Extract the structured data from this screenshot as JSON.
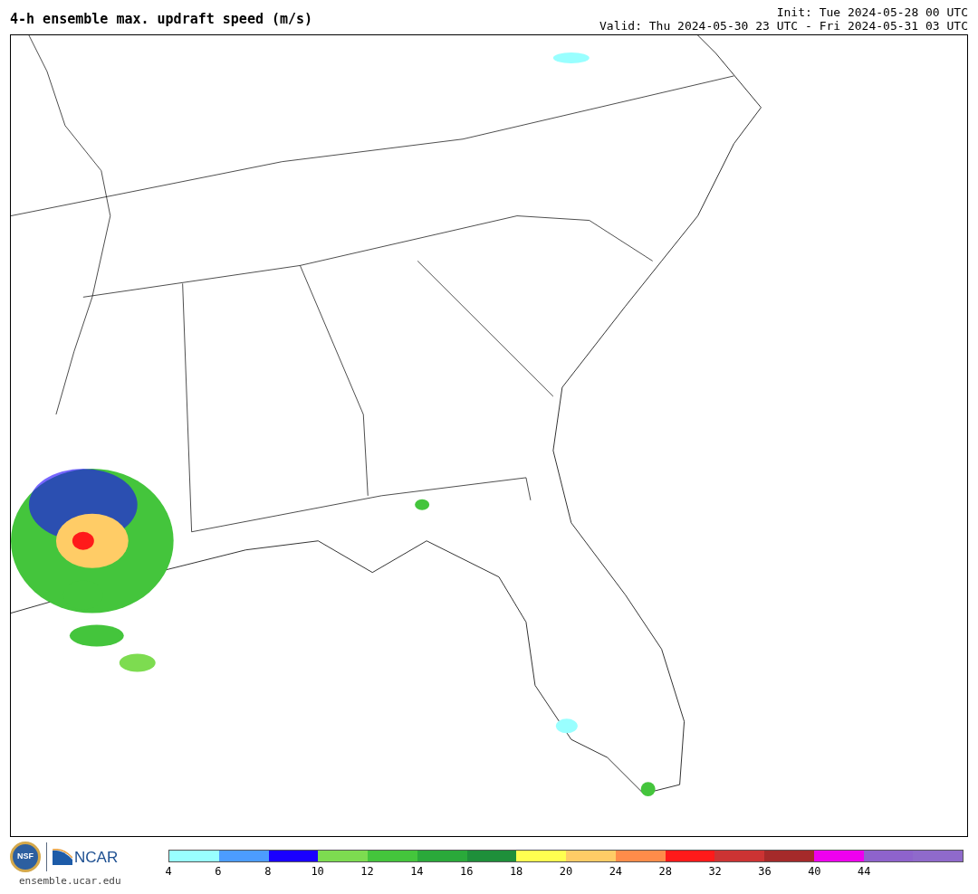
{
  "title": "4-h ensemble max. updraft speed (m/s)",
  "init": "Init: Tue 2024-05-28 00 UTC",
  "valid": "Valid: Thu 2024-05-30 23 UTC - Fri 2024-05-31 03 UTC",
  "logos": {
    "nsf": "NSF",
    "ncar": "NCAR",
    "site": "ensemble.ucar.edu"
  },
  "colorbar": {
    "bins": [
      {
        "color": "#99ffff"
      },
      {
        "color": "#4c9cff"
      },
      {
        "color": "#1a00ff"
      },
      {
        "color": "#7ddc50"
      },
      {
        "color": "#44c53c"
      },
      {
        "color": "#2aa93a"
      },
      {
        "color": "#1e8f3a"
      },
      {
        "color": "#ffff50"
      },
      {
        "color": "#ffcc66"
      },
      {
        "color": "#ff8c4a"
      },
      {
        "color": "#ff1a1a"
      },
      {
        "color": "#cc3333"
      },
      {
        "color": "#a52a2a"
      },
      {
        "color": "#ee00ee"
      },
      {
        "color": "#8e63cc"
      },
      {
        "color": "#8f6acb"
      }
    ],
    "ticks": [
      "4",
      "6",
      "8",
      "10",
      "12",
      "14",
      "16",
      "18",
      "20",
      "24",
      "28",
      "32",
      "36",
      "40",
      "44"
    ]
  }
}
